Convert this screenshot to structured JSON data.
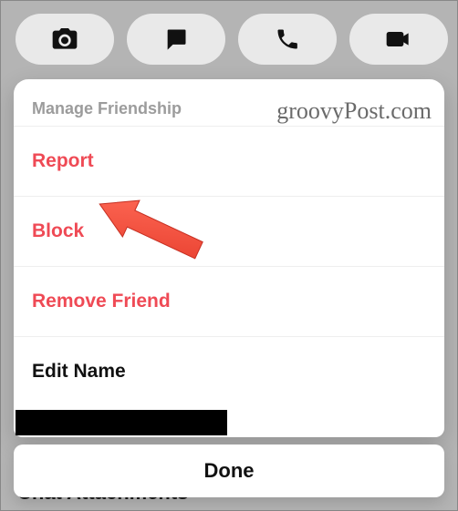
{
  "toolbar": {
    "items": [
      {
        "name": "camera-icon"
      },
      {
        "name": "chat-icon"
      },
      {
        "name": "phone-icon"
      },
      {
        "name": "video-icon"
      }
    ]
  },
  "sheet": {
    "header": "Manage Friendship",
    "rows": [
      {
        "label": "Report",
        "style": "danger"
      },
      {
        "label": "Block",
        "style": "danger"
      },
      {
        "label": "Remove Friend",
        "style": "danger"
      },
      {
        "label": "Edit Name",
        "style": "normal"
      }
    ]
  },
  "done_label": "Done",
  "background_partial_text": "Chat Attachments",
  "watermark": "groovyPost.com",
  "annotation": {
    "arrow_points_to": "Block"
  },
  "colors": {
    "danger": "#ef4a55",
    "pill_bg": "#e9e9e9",
    "backdrop": "#b4b4b4"
  }
}
